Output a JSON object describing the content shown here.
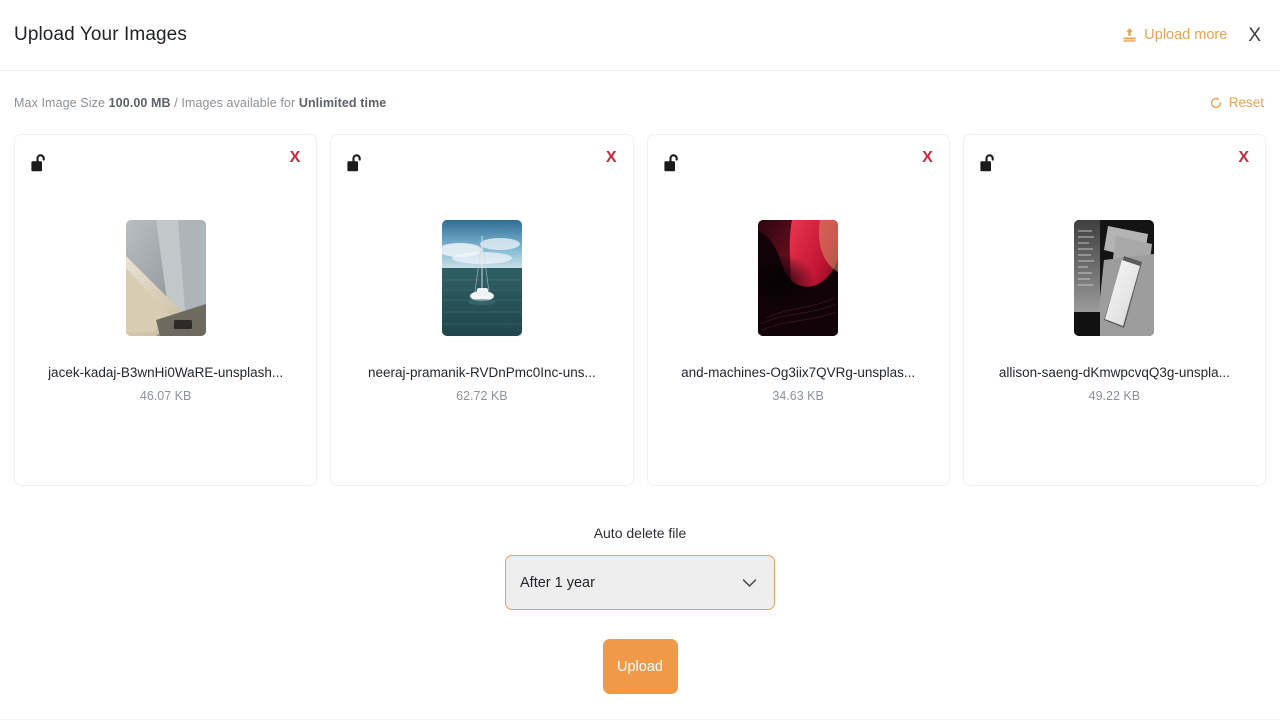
{
  "header": {
    "title": "Upload Your Images",
    "upload_more_label": "Upload more",
    "upload_more_icon": "upload-icon",
    "close_icon": "close-icon",
    "close_label": "X",
    "accent_color": "#e9a24f"
  },
  "info": {
    "prefix": "Max Image Size ",
    "max_size": "100.00 MB",
    "middle": " / Images available for ",
    "availability": "Unlimited time",
    "reset_label": "Reset",
    "reset_icon": "refresh-icon"
  },
  "cards": [
    {
      "lock_icon": "unlock-icon",
      "remove_label": "X",
      "filename": "jacek-kadaj-B3wnHi0WaRE-unsplash...",
      "filesize": "46.07 KB",
      "thumb_alt": "tan-and-gray-panels-photo"
    },
    {
      "lock_icon": "unlock-icon",
      "remove_label": "X",
      "filename": "neeraj-pramanik-RVDnPmc0Inc-uns...",
      "filesize": "62.72 KB",
      "thumb_alt": "sailboat-on-ocean-photo"
    },
    {
      "lock_icon": "unlock-icon",
      "remove_label": "X",
      "filename": "and-machines-Og3iix7QVRg-unsplas...",
      "filesize": "34.63 KB",
      "thumb_alt": "red-black-abstract-wave-photo"
    },
    {
      "lock_icon": "unlock-icon",
      "remove_label": "X",
      "filename": "allison-saeng-dKmwpcvqQ3g-unspla...",
      "filesize": "49.22 KB",
      "thumb_alt": "grayscale-phone-and-cards-photo"
    }
  ],
  "footer": {
    "auto_delete_label": "Auto delete file",
    "auto_delete_value": "After 1 year",
    "chevron_icon": "chevron-down-icon",
    "upload_button_label": "Upload",
    "upload_button_color": "#ef9949"
  }
}
